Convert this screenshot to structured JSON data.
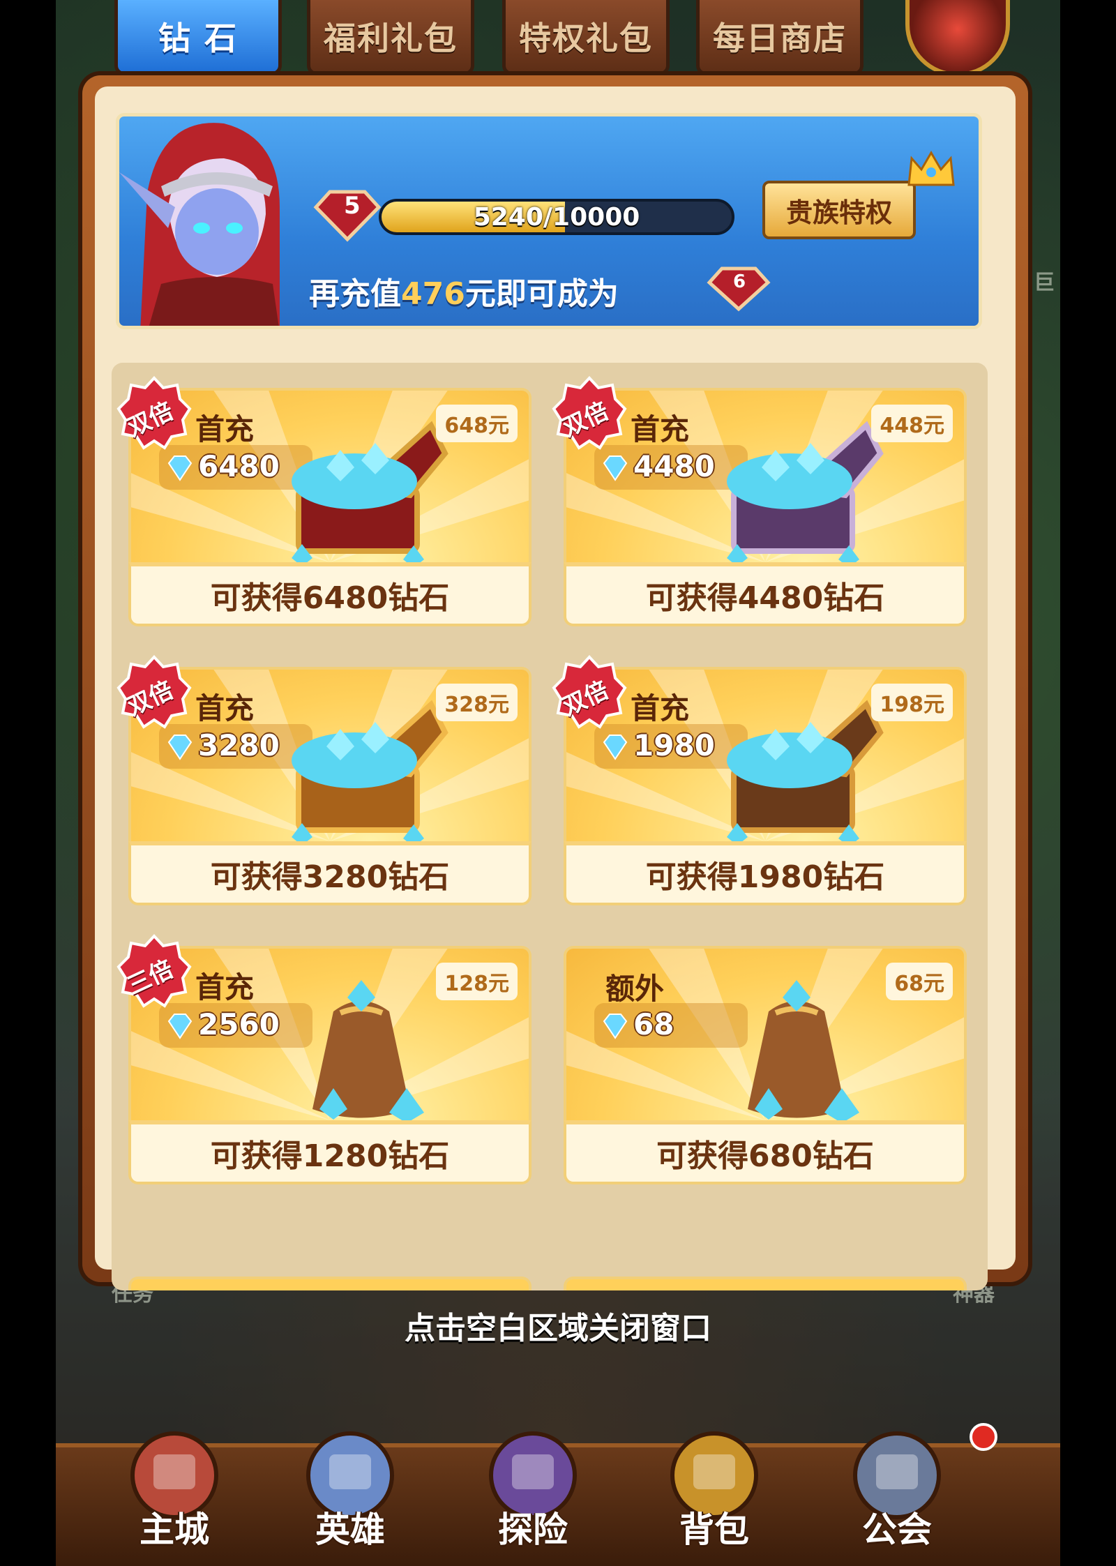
{
  "tabs": [
    {
      "label": "钻 石",
      "active": true
    },
    {
      "label": "福利礼包",
      "active": false
    },
    {
      "label": "特权礼包",
      "active": false
    },
    {
      "label": "每日商店",
      "active": false
    }
  ],
  "vip": {
    "level": "5",
    "next_level": "6",
    "progress_text": "5240/10000",
    "progress_fraction": 0.524,
    "msg_prefix": "再充值",
    "msg_amount": "476",
    "msg_suffix": "元即可成为",
    "noble_button": "贵族特权"
  },
  "products": [
    {
      "badge": "双倍",
      "tag": "首充",
      "amount": "6480",
      "price": "648元",
      "caption": "可获得6480钻石",
      "chest": "red"
    },
    {
      "badge": "双倍",
      "tag": "首充",
      "amount": "4480",
      "price": "448元",
      "caption": "可获得4480钻石",
      "chest": "purple"
    },
    {
      "badge": "双倍",
      "tag": "首充",
      "amount": "3280",
      "price": "328元",
      "caption": "可获得3280钻石",
      "chest": "gold"
    },
    {
      "badge": "双倍",
      "tag": "首充",
      "amount": "1980",
      "price": "198元",
      "caption": "可获得1980钻石",
      "chest": "wood"
    },
    {
      "badge": "三倍",
      "tag": "首充",
      "amount": "2560",
      "price": "128元",
      "caption": "可获得1280钻石",
      "chest": "bag"
    },
    {
      "badge": "",
      "tag": "额外",
      "amount": "68",
      "price": "68元",
      "caption": "可获得680钻石",
      "chest": "bag2"
    }
  ],
  "close_hint": "点击空白区域关闭窗口",
  "background_labels": {
    "left": "任务",
    "right": "神器",
    "side": "巨"
  },
  "bottom_nav": [
    {
      "label": "主城",
      "icon": "castle-icon"
    },
    {
      "label": "英雄",
      "icon": "hero-icon"
    },
    {
      "label": "探险",
      "icon": "portal-icon"
    },
    {
      "label": "背包",
      "icon": "backpack-icon"
    },
    {
      "label": "公会",
      "icon": "guild-icon"
    }
  ],
  "colors": {
    "accent_blue": "#2f7fd8",
    "gold": "#ffd05a",
    "brown": "#6a3310",
    "badge_red": "#d8283a"
  }
}
